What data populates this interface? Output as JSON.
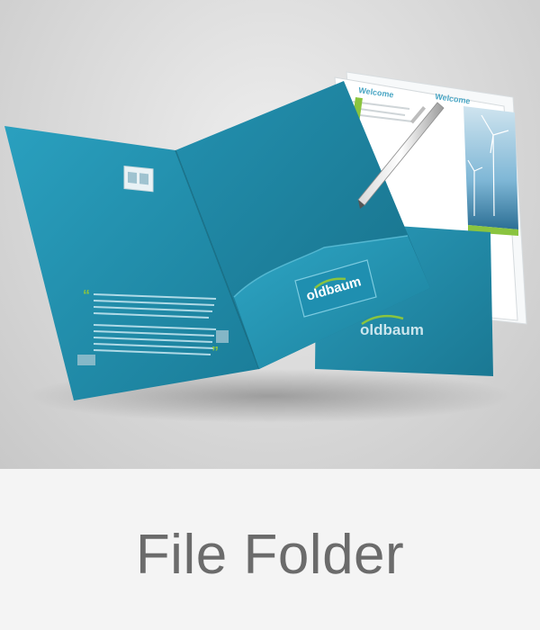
{
  "caption": "File Folder",
  "mockup": {
    "brand_name": "oldbaum",
    "brochure_heading": "Welcome",
    "colors": {
      "folder": "#1f8aa8",
      "folder_dark": "#17708a",
      "pocket": "#2596b4",
      "accent_green": "#8ac43f",
      "caption": "#6b6b6b",
      "background": "#f4f4f4"
    },
    "icons": [
      "pen-icon",
      "wind-turbine-icon",
      "quote-icon"
    ]
  }
}
